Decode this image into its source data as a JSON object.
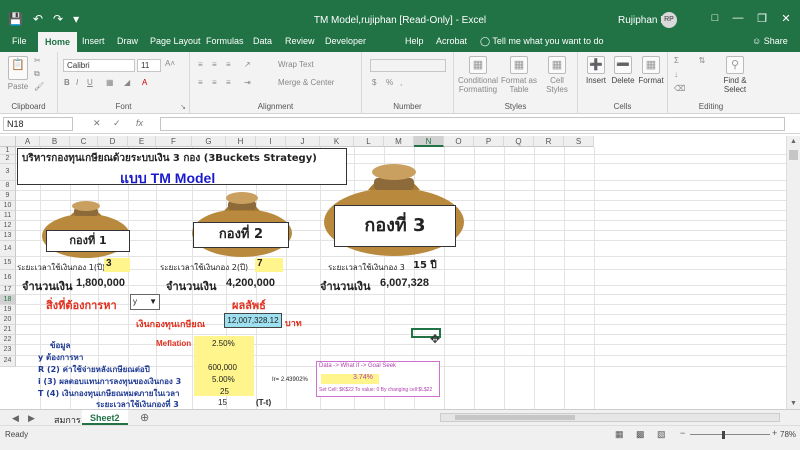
{
  "window": {
    "title": "TM Model,rujiphan  [Read-Only]  -  Excel",
    "user": "Rujiphan P.",
    "avatar": "RP"
  },
  "tabs": [
    "File",
    "Home",
    "Insert",
    "Draw",
    "Page Layout",
    "Formulas",
    "Data",
    "Review",
    "Developer",
    "Help",
    "Acrobat"
  ],
  "tell_me": "Tell me what you want to do",
  "share": "Share",
  "ribbon": {
    "clipboard": {
      "paste": "Paste",
      "label": "Clipboard"
    },
    "font": {
      "name": "Calibri",
      "size": "11",
      "label": "Font"
    },
    "alignment": {
      "wrap": "Wrap Text",
      "merge": "Merge & Center",
      "label": "Alignment"
    },
    "number": {
      "label": "Number"
    },
    "styles": {
      "conditional": "Conditional Formatting",
      "format_table": "Format as Table",
      "cell_styles": "Cell Styles",
      "label": "Styles"
    },
    "cells": {
      "insert": "Insert",
      "delete": "Delete",
      "format": "Format",
      "label": "Cells"
    },
    "editing": {
      "find": "Find & Select",
      "label": "Editing"
    }
  },
  "formula_bar": {
    "name_box": "N18",
    "fx": "fx",
    "value": ""
  },
  "columns": [
    "A",
    "B",
    "C",
    "D",
    "E",
    "F",
    "G",
    "H",
    "I",
    "J",
    "K",
    "L",
    "M",
    "N",
    "O",
    "P",
    "Q",
    "R",
    "S"
  ],
  "rows": [
    "1",
    "2",
    "3",
    "8",
    "9",
    "10",
    "11",
    "12",
    "13",
    "14",
    "15",
    "16",
    "17",
    "18",
    "19",
    "20",
    "21",
    "22",
    "23",
    "24"
  ],
  "selected": {
    "column": "N",
    "row": "18"
  },
  "sheet": {
    "title_line1": "บริหารกองทุนเกษียณด้วยระบบเงิน 3 กอง (3Buckets Strategy)",
    "title_line2": "แบบ TM Model",
    "bucket1_label": "กองที่ 1",
    "bucket2_label": "กองที่ 2",
    "bucket3_label": "กองที่ 3",
    "period1_label": "ระยะเวลาใช้เงินกอง 1(ปี)",
    "period1_value": "3",
    "period2_label": "ระยะเวลาใช้เงินกอง 2(ปี)",
    "period2_value": "7",
    "period3_label": "ระยะเวลาใช้เงินกอง 3",
    "period3_value": "15 ปี",
    "amount_label": "จำนวนเงิน",
    "amount1": "1,800,000",
    "amount2": "4,200,000",
    "amount3": "6,007,328",
    "wanted_label": "สิ่งที่ต้องการหา",
    "dropdown_value": "y",
    "result_label": "ผลลัพธ์",
    "fund_label": "เงินกองทุนเกษียณ",
    "fund_value": "12,007,328.12",
    "baht": "บาท",
    "data_label": "ข้อมูล",
    "y_label": "y ต้องการหา",
    "r_label": "R (2) ค่าใช้จ่ายหลังเกษียณต่อปี",
    "i_label": "i (3) ผลตอบแทนการลงทุนของเงินกอง 3",
    "t_label": "T (4) เงินกองทุนเกษียณหมดภายในเวลา",
    "inflation_label": "Meflation",
    "inflation_value": "2.50%",
    "r_value": "600,000",
    "i_value": "5.00%",
    "t_value": "25",
    "period3b_label": "ระยะเวลาใช้เงินกองที่ 3",
    "period3b_value": "15",
    "tt_label": "(T-t)",
    "ir_label": "Ir= 2.43902%",
    "goal_title": "Data -> What if -> Goal Seek",
    "goal_value": "3.74%",
    "goal_note": "Set Cell: $K$22 To value: 0 By changing cell:$L$22"
  },
  "sheet_tabs": [
    "สมการ",
    "Sheet2"
  ],
  "active_sheet": "Sheet2",
  "status": {
    "ready": "Ready",
    "zoom": "78%"
  }
}
